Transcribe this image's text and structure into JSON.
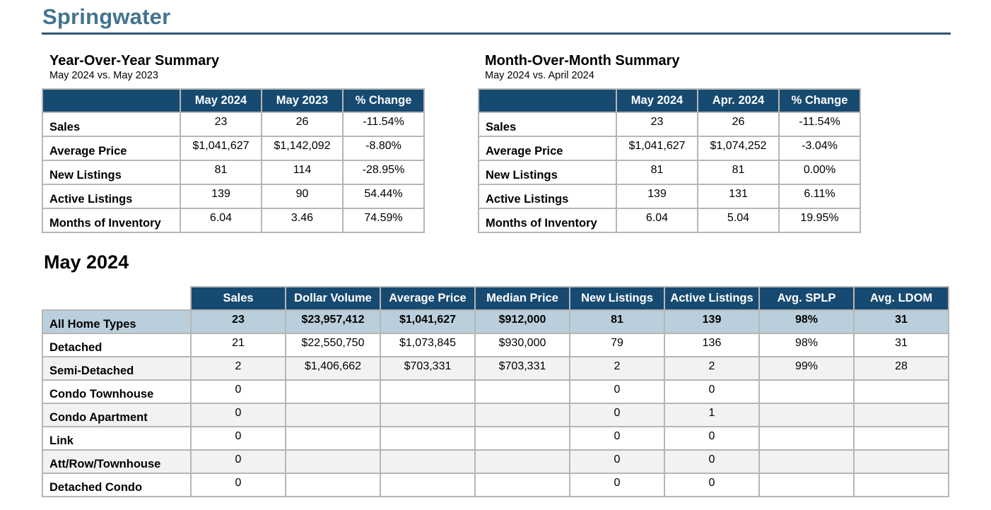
{
  "page": {
    "title": "Springwater"
  },
  "yoy": {
    "title": "Year-Over-Year Summary",
    "subtitle": "May 2024 vs. May 2023",
    "headers": [
      "May 2024",
      "May 2023",
      "% Change"
    ],
    "rows": [
      {
        "label": "Sales",
        "values": [
          "23",
          "26",
          "-11.54%"
        ]
      },
      {
        "label": "Average Price",
        "values": [
          "$1,041,627",
          "$1,142,092",
          "-8.80%"
        ]
      },
      {
        "label": "New Listings",
        "values": [
          "81",
          "114",
          "-28.95%"
        ]
      },
      {
        "label": "Active Listings",
        "values": [
          "139",
          "90",
          "54.44%"
        ]
      },
      {
        "label": "Months of Inventory",
        "values": [
          "6.04",
          "3.46",
          "74.59%"
        ]
      }
    ]
  },
  "mom": {
    "title": "Month-Over-Month Summary",
    "subtitle": "May 2024 vs. April 2024",
    "headers": [
      "May 2024",
      "Apr. 2024",
      "% Change"
    ],
    "rows": [
      {
        "label": "Sales",
        "values": [
          "23",
          "26",
          "-11.54%"
        ]
      },
      {
        "label": "Average Price",
        "values": [
          "$1,041,627",
          "$1,074,252",
          "-3.04%"
        ]
      },
      {
        "label": "New Listings",
        "values": [
          "81",
          "81",
          "0.00%"
        ]
      },
      {
        "label": "Active Listings",
        "values": [
          "139",
          "131",
          "6.11%"
        ]
      },
      {
        "label": "Months of Inventory",
        "values": [
          "6.04",
          "5.04",
          "19.95%"
        ]
      }
    ]
  },
  "month": {
    "title": "May 2024",
    "headers": [
      "Sales",
      "Dollar Volume",
      "Average Price",
      "Median Price",
      "New Listings",
      "Active Listings",
      "Avg. SPLP",
      "Avg. LDOM"
    ],
    "rows": [
      {
        "label": "All Home Types",
        "values": [
          "23",
          "$23,957,412",
          "$1,041,627",
          "$912,000",
          "81",
          "139",
          "98%",
          "31"
        ]
      },
      {
        "label": "Detached",
        "values": [
          "21",
          "$22,550,750",
          "$1,073,845",
          "$930,000",
          "79",
          "136",
          "98%",
          "31"
        ]
      },
      {
        "label": "Semi-Detached",
        "values": [
          "2",
          "$1,406,662",
          "$703,331",
          "$703,331",
          "2",
          "2",
          "99%",
          "28"
        ]
      },
      {
        "label": "Condo Townhouse",
        "values": [
          "0",
          "",
          "",
          "",
          "0",
          "0",
          "",
          ""
        ]
      },
      {
        "label": "Condo Apartment",
        "values": [
          "0",
          "",
          "",
          "",
          "0",
          "1",
          "",
          ""
        ]
      },
      {
        "label": "Link",
        "values": [
          "0",
          "",
          "",
          "",
          "0",
          "0",
          "",
          ""
        ]
      },
      {
        "label": "Att/Row/Townhouse",
        "values": [
          "0",
          "",
          "",
          "",
          "0",
          "0",
          "",
          ""
        ]
      },
      {
        "label": "Detached Condo",
        "values": [
          "0",
          "",
          "",
          "",
          "0",
          "0",
          "",
          ""
        ]
      }
    ]
  }
}
